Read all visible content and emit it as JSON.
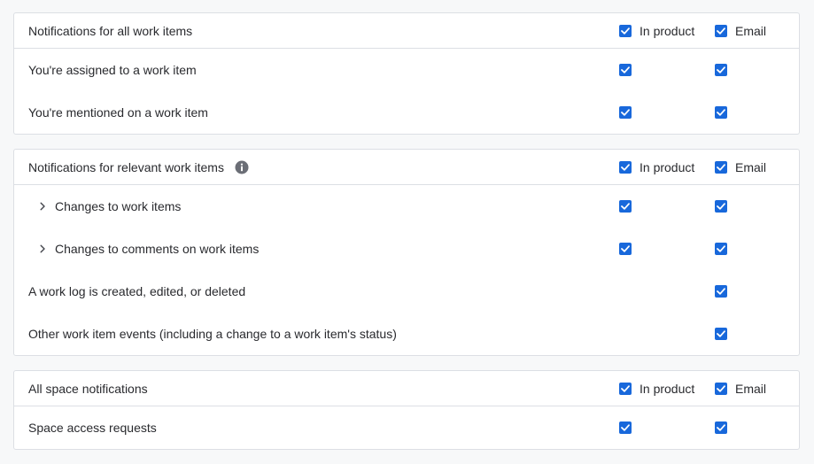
{
  "colors": {
    "checkbox": "#1868db",
    "panel_border": "#dcdfe4",
    "background": "#f7f8f9",
    "info_icon": "#6b6e76"
  },
  "columns": {
    "in_product": "In product",
    "email": "Email"
  },
  "sections": [
    {
      "title": "Notifications for all work items",
      "rows": [
        {
          "label": "You're assigned to a work item",
          "in_product": true,
          "email": true
        },
        {
          "label": "You're mentioned on a work item",
          "in_product": true,
          "email": true
        }
      ]
    },
    {
      "title": "Notifications for relevant work items",
      "info_icon": "info-icon",
      "rows": [
        {
          "label": "Changes to work items",
          "expandable": true,
          "in_product": true,
          "email": true
        },
        {
          "label": "Changes to comments on work items",
          "expandable": true,
          "in_product": true,
          "email": true
        },
        {
          "label": "A work log is created, edited, or deleted",
          "email": true
        },
        {
          "label": "Other work item events (including a change to a work item's status)",
          "email": true
        }
      ]
    },
    {
      "title": "All space notifications",
      "rows": [
        {
          "label": "Space access requests",
          "in_product": true,
          "email": true
        }
      ]
    }
  ]
}
